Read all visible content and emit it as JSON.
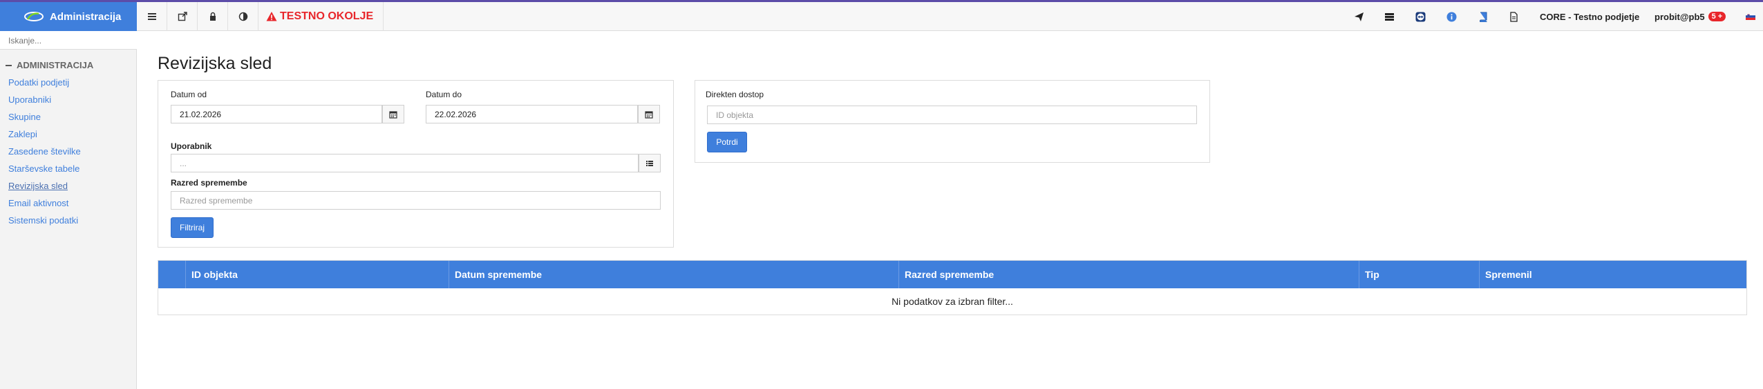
{
  "colors": {
    "accent": "#3f7fdc",
    "warning": "#e8262b",
    "top_line": "#5c4ca8"
  },
  "header": {
    "brand": "Administracija",
    "toolbar_icons": [
      "menu-icon",
      "external-link-icon",
      "lock-icon",
      "contrast-icon"
    ],
    "warning": "TESTNO OKOLJE",
    "right_icons": [
      "send-icon",
      "server-icon",
      "teamviewer-icon",
      "info-icon",
      "book-icon",
      "document-icon"
    ],
    "company": "CORE - Testno podjetje",
    "user": "probit@pb5",
    "user_badge": "5 +",
    "language_flag": "slovenian-flag-icon"
  },
  "sidebar": {
    "search_placeholder": "Iskanje...",
    "section": "ADMINISTRACIJA",
    "items": [
      {
        "label": "Podatki podjetij"
      },
      {
        "label": "Uporabniki"
      },
      {
        "label": "Skupine"
      },
      {
        "label": "Zaklepi"
      },
      {
        "label": "Zasedene številke"
      },
      {
        "label": "Starševske tabele"
      },
      {
        "label": "Revizijska sled"
      },
      {
        "label": "Email aktivnost"
      },
      {
        "label": "Sistemski podatki"
      }
    ],
    "active": "Revizijska sled"
  },
  "page": {
    "title": "Revizijska sled"
  },
  "filter": {
    "date_from_label": "Datum od",
    "date_from_value": "21.02.2026",
    "date_to_label": "Datum do",
    "date_to_value": "22.02.2026",
    "user_label": "Uporabnik",
    "user_placeholder": "...",
    "change_class_label": "Razred spremembe",
    "change_class_placeholder": "Razred spremembe",
    "filter_button": "Filtriraj"
  },
  "direct_access": {
    "label": "Direkten dostop",
    "object_id_placeholder": "ID objekta",
    "confirm_button": "Potrdi"
  },
  "table": {
    "columns": [
      "",
      "ID objekta",
      "Datum spremembe",
      "Razred spremembe",
      "Tip",
      "Spremenil"
    ],
    "empty_message": "Ni podatkov za izbran filter..."
  }
}
